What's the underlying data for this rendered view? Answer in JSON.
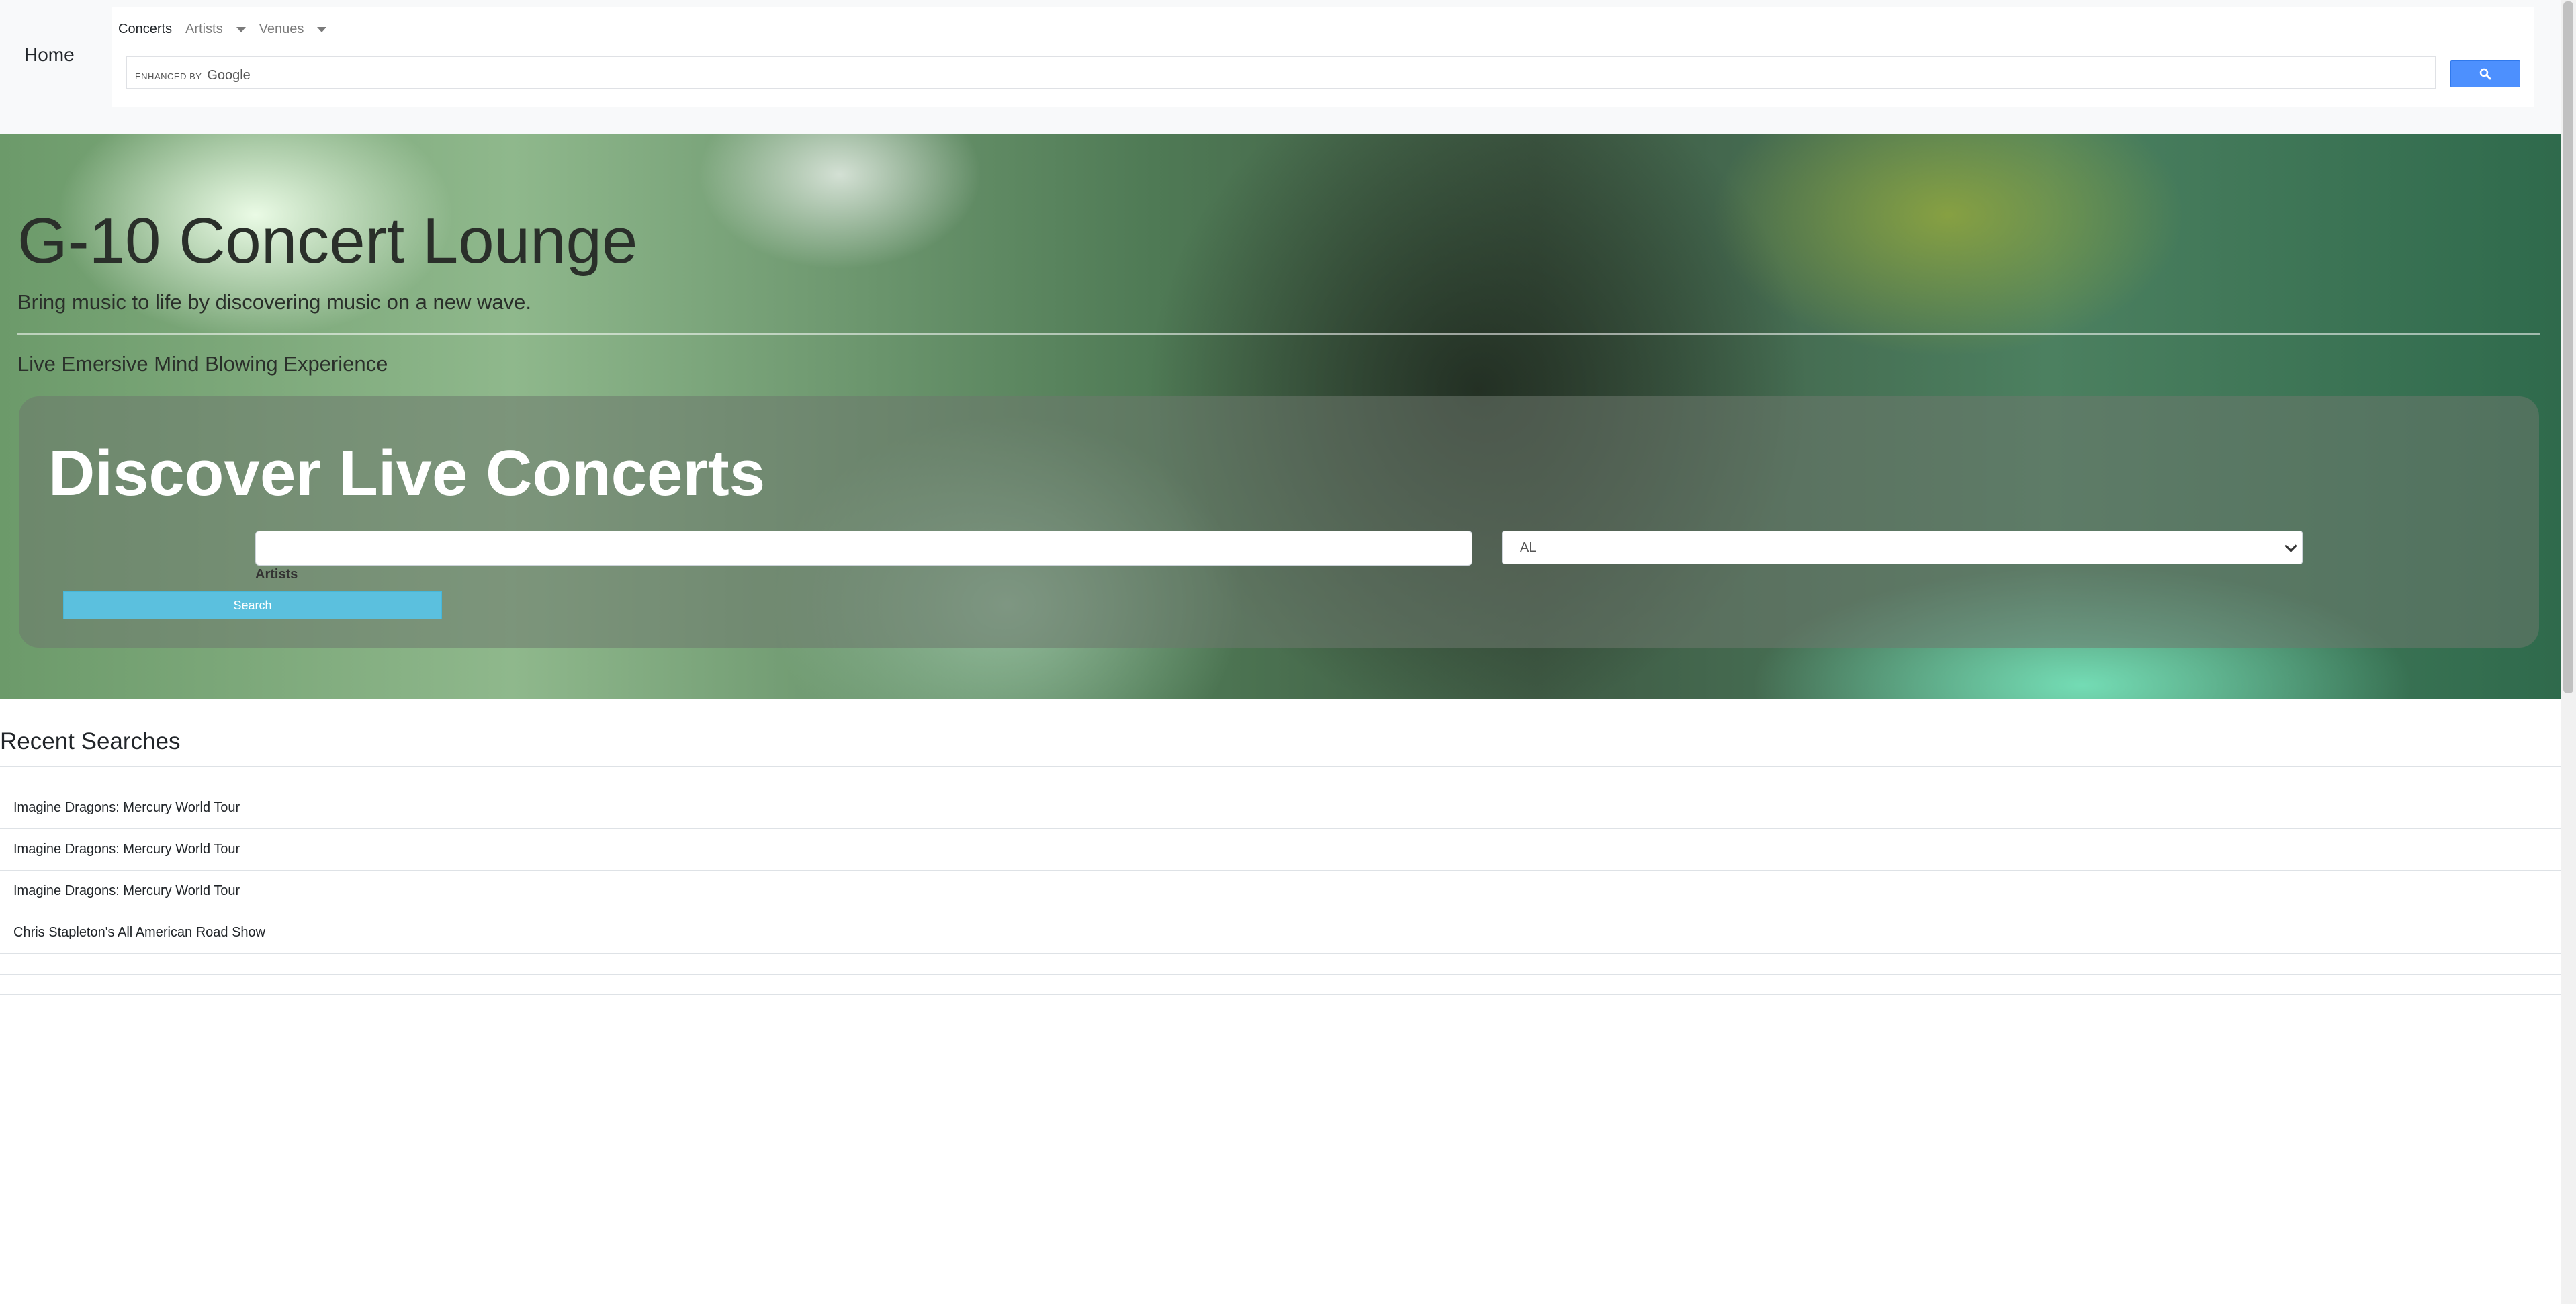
{
  "navbar": {
    "brand": "Home",
    "links": [
      {
        "label": "Concerts"
      },
      {
        "label": "Artists"
      },
      {
        "label": "Venues"
      }
    ],
    "google_search": {
      "enhanced_by": "ENHANCED BY",
      "google": "Google",
      "button_icon": "search-icon"
    }
  },
  "hero": {
    "title": "G-10 Concert Lounge",
    "lead": "Bring music to life by discovering music on a new wave.",
    "experience": "Live Emersive Mind Blowing Experience",
    "panel": {
      "heading": "Discover Live Concerts",
      "artist_input_value": "",
      "artist_label": "Artists",
      "state_selected": "AL",
      "search_button": "Search"
    }
  },
  "recent": {
    "title": "Recent Searches",
    "items": [
      "",
      "Imagine Dragons: Mercury World Tour",
      "Imagine Dragons: Mercury World Tour",
      "Imagine Dragons: Mercury World Tour",
      "Chris Stapleton's All American Road Show",
      "",
      ""
    ]
  },
  "colors": {
    "google_button": "#4d90fe",
    "search_button": "#5bc0de",
    "navbar_bg": "#f8f9fa"
  }
}
